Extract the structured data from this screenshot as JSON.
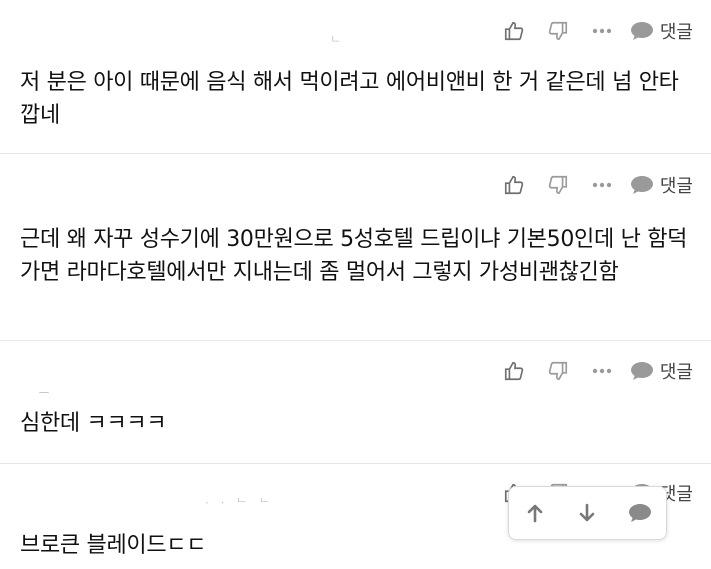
{
  "comments": [
    {
      "text": "저 분은 아이 때문에 음식 해서 먹이려고 에어비앤비 한 거 같은데 넘 안타깝네",
      "reply_label": "댓글"
    },
    {
      "text": "근데 왜 자꾸 성수기에 30만원으로 5성호텔 드립이냐 기본50인데 난 함덕가면 라마다호텔에서만 지내는데 좀 멀어서 그렇지 가성비괜찮긴함",
      "reply_label": "댓글"
    },
    {
      "text": "심한데 ㅋㅋㅋㅋ",
      "reply_label": "댓글"
    },
    {
      "text": "브로큰 블레이드ㄷㄷ",
      "reply_label": "댓글"
    }
  ],
  "icons": {
    "like": "thumbs-up-icon",
    "dislike": "thumbs-down-icon",
    "more": "more-dots-icon",
    "reply": "speech-bubble-icon",
    "scroll_up": "arrow-up-icon",
    "scroll_down": "arrow-down-icon",
    "comment": "comment-bubble-icon"
  },
  "colors": {
    "icon": "#8a8a8a",
    "bubble": "#9a9a9a",
    "text": "#111111",
    "divider": "#e6e6e6"
  }
}
